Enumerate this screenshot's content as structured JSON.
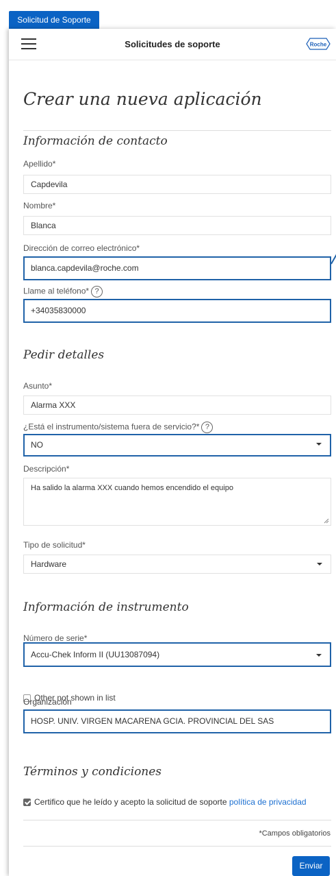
{
  "tab": {
    "label": "Solicitud de Soporte"
  },
  "topbar": {
    "title": "Solicitudes de soporte",
    "logo_text": "Roche"
  },
  "page": {
    "title": "Crear una nueva aplicación"
  },
  "contact": {
    "heading": "Información de contacto",
    "surname_label": "Apellido*",
    "surname_value": "Capdevila",
    "name_label": "Nombre*",
    "name_value": "Blanca",
    "email_label": "Dirección de correo electrónico*",
    "email_value": "blanca.capdevila@roche.com",
    "phone_label": "Llame al teléfono*",
    "phone_value": "+34035830000"
  },
  "details": {
    "heading": "Pedir detalles",
    "subject_label": "Asunto*",
    "subject_value": "Alarma XXX",
    "out_of_service_label": "¿Está el instrumento/sistema fuera de servicio?*",
    "out_of_service_value": "NO",
    "description_label": "Descripción*",
    "description_value": "Ha salido la alarma XXX cuando hemos encendido el equipo",
    "request_type_label": "Tipo de solicitud*",
    "request_type_value": "Hardware"
  },
  "instrument": {
    "heading": "Información de instrumento",
    "serial_label": "Número de serie*",
    "serial_value": "Accu-Chek Inform II (UU13087094)",
    "other_label": "Other not shown in list",
    "org_label": "Organización",
    "org_value": "HOSP. UNIV. VIRGEN MACARENA GCIA. PROVINCIAL DEL SAS"
  },
  "terms": {
    "heading": "Términos y condiciones",
    "text": "Certifico que he leído y acepto la solicitud de soporte ",
    "link": "política de privacidad",
    "checked": true
  },
  "footer": {
    "required_note": "*Campos obligatorios",
    "submit_label": "Enviar"
  },
  "help_glyph": "?",
  "colors": {
    "primary": "#0b63c4",
    "focus_border": "#1f62a8",
    "link": "#1b6fd1"
  }
}
